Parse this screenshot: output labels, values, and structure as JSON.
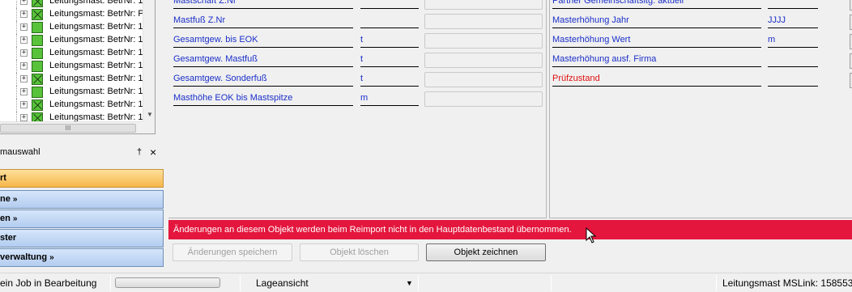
{
  "tree": {
    "items": [
      {
        "label": "Leitungsmast:  BetrNr: 1",
        "icon": "mast-icon-crossed"
      },
      {
        "label": "Leitungsmast:  BetrNr: P",
        "icon": "mast-icon-crossed"
      },
      {
        "label": "Leitungsmast:  BetrNr: 1",
        "icon": "mast-icon"
      },
      {
        "label": "Leitungsmast:  BetrNr: 1",
        "icon": "mast-icon"
      },
      {
        "label": "Leitungsmast:  BetrNr: 1",
        "icon": "mast-icon"
      },
      {
        "label": "Leitungsmast:  BetrNr: 1",
        "icon": "mast-icon"
      },
      {
        "label": "Leitungsmast:  BetrNr: 1",
        "icon": "mast-icon-crossed"
      },
      {
        "label": "Leitungsmast:  BetrNr: 1",
        "icon": "mast-icon"
      },
      {
        "label": "Leitungsmast:  BetrNr: 1",
        "icon": "mast-icon-crossed"
      },
      {
        "label": "Leitungsmast:  BetrNr: 1",
        "icon": "mast-icon-crossed"
      }
    ],
    "expand_glyph": "+",
    "hscroll_grip": "III"
  },
  "panel": {
    "title": "mauswahl",
    "pin_glyph": "†",
    "close_glyph": "×",
    "nav": [
      {
        "label": "rt",
        "arrow": ""
      },
      {
        "label": "ne",
        "arrow": "»"
      },
      {
        "label": "en",
        "arrow": "»"
      },
      {
        "label": "ster",
        "arrow": ""
      },
      {
        "label": "verwaltung",
        "arrow": "»"
      }
    ]
  },
  "form": {
    "left_rows": [
      {
        "label": "Mastschaft Z.Nr",
        "unit": "",
        "value": ""
      },
      {
        "label": "Mastfuß Z.Nr",
        "unit": "",
        "value": ""
      },
      {
        "label": "Gesamtgew. bis EOK",
        "unit": "t",
        "value": ""
      },
      {
        "label": "Gesamtgew. Mastfuß",
        "unit": "t",
        "value": ""
      },
      {
        "label": "Gesamtgew. Sonderfuß",
        "unit": "t",
        "value": ""
      },
      {
        "label": "Masthöhe EOK bis Mastspitze",
        "unit": "m",
        "value": ""
      }
    ],
    "right_rows": [
      {
        "label": "Partner Gemeinschaftsltg. aktuell",
        "unit": "",
        "red": false
      },
      {
        "label": "Masterhöhung Jahr",
        "unit": "JJJJ",
        "red": false
      },
      {
        "label": "Masterhöhung Wert",
        "unit": "m",
        "red": false
      },
      {
        "label": "Masterhöhung ausf. Firma",
        "unit": "",
        "red": false
      },
      {
        "label": "Prüfzustand",
        "unit": "",
        "red": true
      }
    ]
  },
  "warning": {
    "text": "Änderungen an diesem Objekt werden beim Reimport nicht in den Hauptdatenbestand übernommen."
  },
  "actions": {
    "save_label": "Änderungen speichern",
    "delete_label": "Objekt löschen",
    "draw_label": "Objekt zeichnen"
  },
  "statusbar": {
    "job_text": "ein Job in Bearbeitung",
    "view_label": "Lageansicht",
    "dropdown_glyph": "▼",
    "mslink_text": "Leitungsmast MSLink: 158553"
  },
  "colors": {
    "label_blue": "#1a2fc9",
    "warning_red": "#e4163d",
    "required_red": "#e01010",
    "nav_active": "#f7b64a",
    "nav_blue": "#b3ccef"
  }
}
